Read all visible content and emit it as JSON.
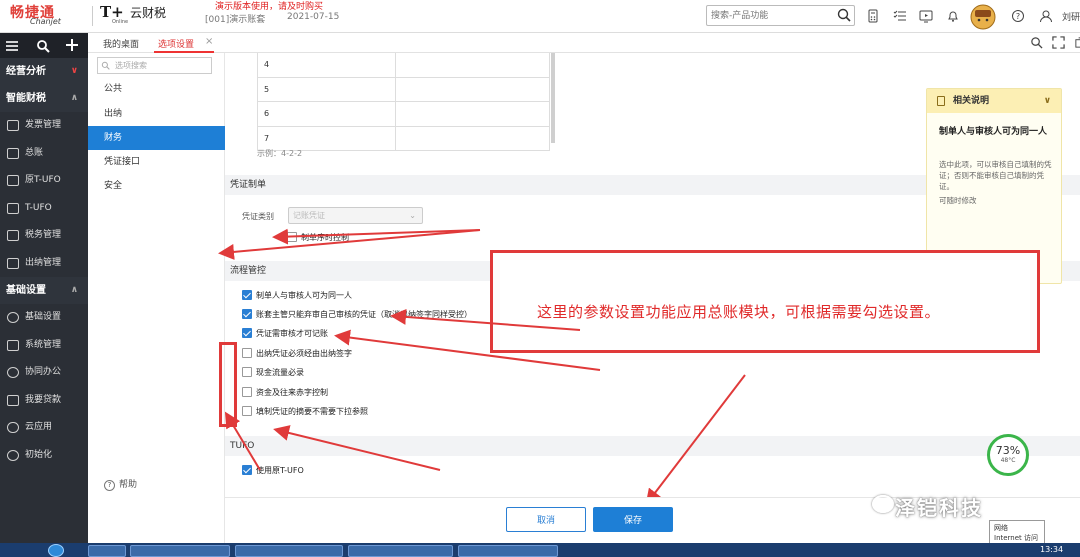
{
  "header": {
    "brand_cn": "畅捷通",
    "brand_en": "Chanjet",
    "tplus_mark": "T+",
    "tplus_online": "Online",
    "tplus_text": "云财税",
    "demo_notice": "演示版本使用，请及时购买",
    "account": "[001]演示账套",
    "date": "2021-07-15",
    "search_placeholder": "搜索-产品功能",
    "user": "刘研"
  },
  "sidebar": {
    "groups": [
      {
        "label": "经营分析"
      },
      {
        "label": "智能财税"
      },
      {
        "label": "基础设置"
      }
    ],
    "items_finance": [
      {
        "label": "发票管理",
        "icon": "invoice-icon"
      },
      {
        "label": "总账",
        "icon": "ledger-icon"
      },
      {
        "label": "原T-UFO",
        "icon": "ufo-icon"
      },
      {
        "label": "T-UFO",
        "icon": "report-icon"
      },
      {
        "label": "税务管理",
        "icon": "tax-icon"
      },
      {
        "label": "出纳管理",
        "icon": "cashier-icon"
      }
    ],
    "items_basic": [
      {
        "label": "基础设置",
        "icon": "gear-icon"
      },
      {
        "label": "系统管理",
        "icon": "system-icon"
      },
      {
        "label": "协同办公",
        "icon": "collab-icon"
      },
      {
        "label": "我要贷款",
        "icon": "loan-icon"
      },
      {
        "label": "云应用",
        "icon": "cloud-icon"
      },
      {
        "label": "初始化",
        "icon": "init-icon"
      }
    ]
  },
  "tabs": {
    "home": "我的桌面",
    "settings": "选项设置",
    "close": "×"
  },
  "leftnav": {
    "search_placeholder": "选项搜索",
    "items": [
      "公共",
      "出纳",
      "财务",
      "凭证接口",
      "安全"
    ],
    "help": "帮助"
  },
  "example_table": {
    "rows": [
      "4",
      "5",
      "6",
      "7"
    ],
    "example": "示例：4-2-2"
  },
  "voucher_section": {
    "title": "凭证制单",
    "type_label": "凭证类别",
    "type_value": "记账凭证",
    "serial_control": "制单序时控制"
  },
  "flow_section": {
    "title": "流程管控",
    "options": [
      {
        "label": "制单人与审核人可为同一人",
        "checked": true
      },
      {
        "label": "账套主管只能弃审自己审核的凭证（取消出纳签字同样受控）",
        "checked": true
      },
      {
        "label": "凭证需审核才可记账",
        "checked": true
      },
      {
        "label": "出纳凭证必须经由出纳签字",
        "checked": false
      },
      {
        "label": "现金流量必录",
        "checked": false
      },
      {
        "label": "资金及往来赤字控制",
        "checked": false
      },
      {
        "label": "填制凭证的摘要不需要下拉参照",
        "checked": false
      }
    ]
  },
  "tufo_section": {
    "title": "TUFO",
    "option": {
      "label": "使用原T-UFO",
      "checked": true
    }
  },
  "info_panel": {
    "header": "相关说明",
    "title": "制单人与审核人可为同一人",
    "desc": "选中此项，可以审核自己填制的凭证；否则不能审核自己填制的凭证。",
    "note": "可随时修改"
  },
  "callout": {
    "text": "这里的参数设置功能应用总账模块，可根据需要勾选设置。"
  },
  "footer": {
    "cancel": "取消",
    "save": "保存"
  },
  "gauge": {
    "percent": "73%",
    "temp": "48°C"
  },
  "watermark": "泽铠科技",
  "tray": {
    "line1": "网络",
    "line2": "Internet 访问"
  },
  "clock": "13:34",
  "colors": {
    "accent": "#1e7fd6",
    "annotation": "#e03a3a",
    "sidebar": "#2b2f36"
  }
}
